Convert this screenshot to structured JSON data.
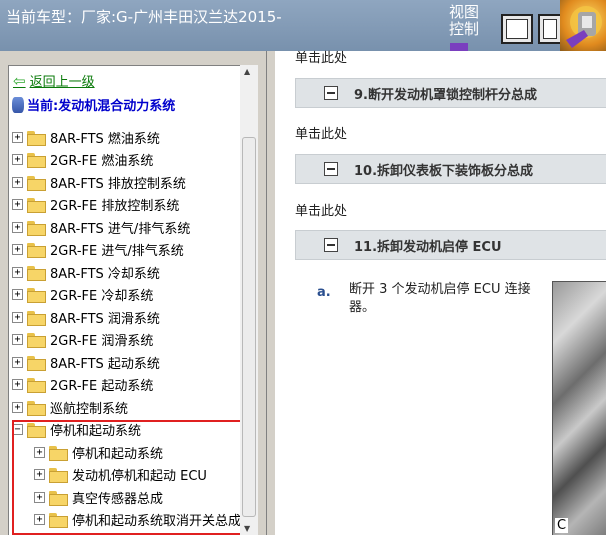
{
  "titlebar": {
    "title": "当前车型：厂家:G-广州丰田汉兰达2015-",
    "view_label": "视图控制",
    "buttons": [
      {
        "name": "view-forward-button",
        "icon": "arrow-right-icon",
        "glyph": "➔"
      },
      {
        "name": "view-partial-button",
        "icon": "arrow-right-icon",
        "glyph": "➔"
      }
    ]
  },
  "nav": {
    "back_label": "返回上一级",
    "current_label": "当前:发动机混合动力系统"
  },
  "tree": {
    "items": [
      {
        "label": "8AR-FTS 燃油系统",
        "expander": "+"
      },
      {
        "label": "2GR-FE 燃油系统",
        "expander": "+"
      },
      {
        "label": "8AR-FTS 排放控制系统",
        "expander": "+"
      },
      {
        "label": "2GR-FE 排放控制系统",
        "expander": "+"
      },
      {
        "label": "8AR-FTS 进气/排气系统",
        "expander": "+"
      },
      {
        "label": "2GR-FE 进气/排气系统",
        "expander": "+"
      },
      {
        "label": "8AR-FTS 冷却系统",
        "expander": "+"
      },
      {
        "label": "2GR-FE 冷却系统",
        "expander": "+"
      },
      {
        "label": "8AR-FTS 润滑系统",
        "expander": "+"
      },
      {
        "label": "2GR-FE 润滑系统",
        "expander": "+"
      },
      {
        "label": "8AR-FTS 起动系统",
        "expander": "+"
      },
      {
        "label": "2GR-FE 起动系统",
        "expander": "+"
      },
      {
        "label": "巡航控制系统",
        "expander": "+"
      },
      {
        "label": "停机和起动系统",
        "expander": "−"
      }
    ],
    "children": [
      {
        "label": "停机和起动系统",
        "expander": "+"
      },
      {
        "label": "发动机停机和起动 ECU",
        "expander": "+"
      },
      {
        "label": "真空传感器总成",
        "expander": "+"
      },
      {
        "label": "停机和起动系统取消开关总成",
        "expander": "+"
      }
    ]
  },
  "content": {
    "click_here": "单击此处",
    "top_click_here": "单击此处",
    "steps": [
      {
        "title": "9.断开发动机罩锁控制杆分总成"
      },
      {
        "title": "10.拆卸仪表板下装饰板分总成"
      },
      {
        "title": "11.拆卸发动机启停 ECU"
      }
    ],
    "sub_step": {
      "letter": "a.",
      "text": "断开 3 个发动机启停 ECU 连接器。"
    },
    "photo_label": "C"
  }
}
